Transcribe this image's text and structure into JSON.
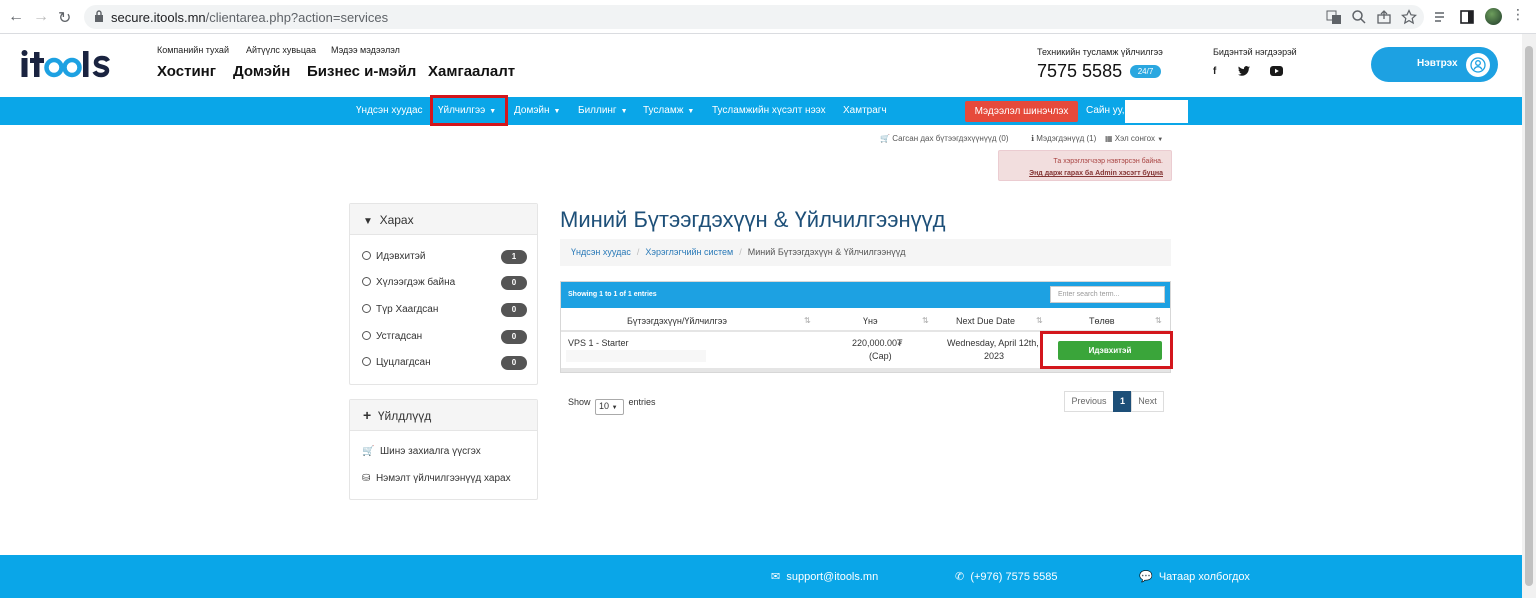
{
  "browser": {
    "url_host": "secure.itools.mn",
    "url_path": "/clientarea.php?action=services"
  },
  "header": {
    "logo": "itools",
    "top_links": [
      "Компанийн тухай",
      "Айтүүлс хувьцаа",
      "Мэдээ мэдээлэл"
    ],
    "main_nav": [
      "Хостинг",
      "Домэйн",
      "Бизнес и-мэйл",
      "Хамгаалалт"
    ],
    "support_label": "Техникийн тусламж үйлчилгээ",
    "phone": "7575 5585",
    "badge": "24/7",
    "social_label": "Бидэнтэй нэгдээрэй",
    "social_icons": [
      "f",
      "twitter-icon",
      "youtube-icon"
    ],
    "login_label": "Нэвтрэх"
  },
  "nav": {
    "items": [
      "Үндсэн хуудас",
      "Үйлчилгээ",
      "Домэйн",
      "Биллинг",
      "Тусламж",
      "Тусламжийн хүсэлт нээх",
      "Хамтрагч"
    ],
    "update_btn": "Мэдээлэл шинэчлэх",
    "greeting": "Сайн уу,"
  },
  "utility": {
    "cart": "Сагсан дах бүтээгдэхүүнүүд (0)",
    "notifications": "Мэдэгдэнүүд (1)",
    "language": "Хэл сонгох"
  },
  "alert": {
    "line1": "Та хэрэглэгчээр нэвтэрсэн байна.",
    "line2": "Энд дарж гарах ба Admin хэсэгт буцна"
  },
  "sidebar": {
    "filter_title": "Харах",
    "filters": [
      {
        "label": "Идэвхитэй",
        "count": "1"
      },
      {
        "label": "Хүлээгдэж байна",
        "count": "0"
      },
      {
        "label": "Түр Хаагдсан",
        "count": "0"
      },
      {
        "label": "Устгадсан",
        "count": "0"
      },
      {
        "label": "Цуцлагдсан",
        "count": "0"
      }
    ],
    "actions_title": "Үйлдлүүд",
    "actions": [
      "Шинэ захиалга үүсгэх",
      "Нэмэлт үйлчилгээнүүд харах"
    ]
  },
  "main": {
    "title": "Миний Бүтээгдэхүүн & Үйлчилгээнүүд",
    "breadcrumb": [
      "Үндсэн хуудас",
      "Хэрэглэгчийн систем",
      "Миний Бүтээгдэхүүн & Үйлчилгээнүүд"
    ],
    "table": {
      "showing": "Showing 1 to 1 of 1 entries",
      "search_placeholder": "Enter search term...",
      "columns": [
        "Бүтээгдэхүүн/Үйлчилгээ",
        "Үнэ",
        "Next Due Date",
        "Төлөв"
      ],
      "rows": [
        {
          "product": "VPS 1 - Starter",
          "price": "220,000.00₮",
          "cycle": "(Сар)",
          "due_line1": "Wednesday, April 12th,",
          "due_line2": "2023",
          "status": "Идэвхитэй"
        }
      ]
    },
    "show_label": "Show",
    "show_value": "10",
    "entries_label": "entries",
    "pagination": [
      "Previous",
      "1",
      "Next"
    ]
  },
  "footer": {
    "email": "support@itools.mn",
    "phone": "(+976) 7575 5585",
    "chat": "Чатаар холбогдох"
  },
  "colors": {
    "brand_blue": "#0aa6e8",
    "success": "#3aa53a",
    "alert_red": "#e64a3b",
    "highlight": "#d3161c"
  }
}
